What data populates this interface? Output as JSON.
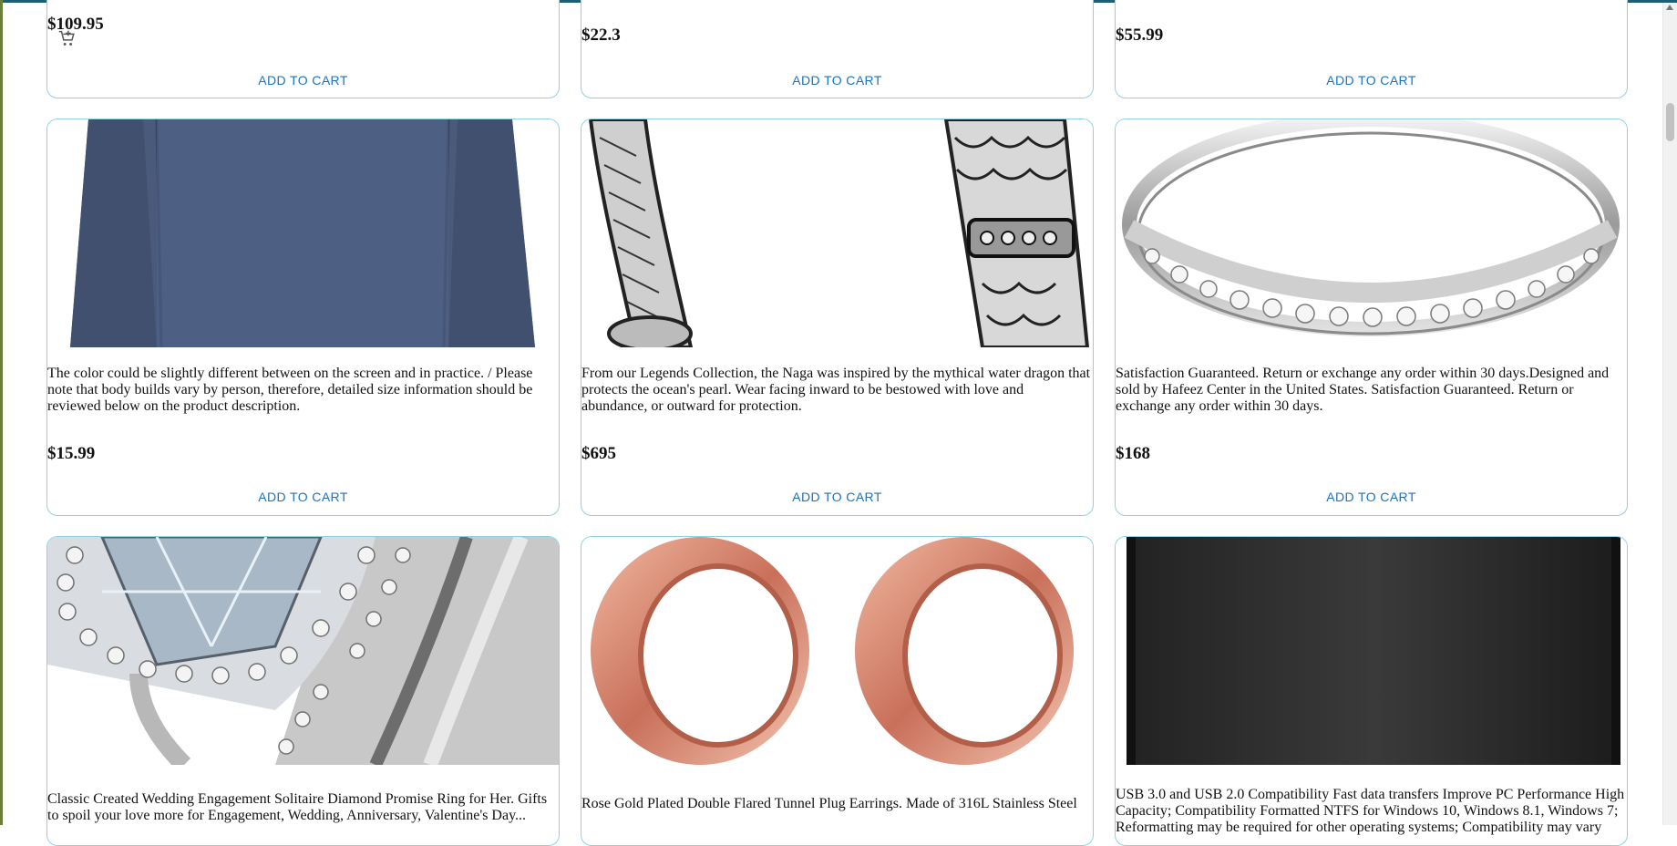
{
  "products": [
    {
      "price": "$109.95",
      "cta": "ADD TO CART"
    },
    {
      "price": "$22.3",
      "cta": "ADD TO CART"
    },
    {
      "price": "$55.99",
      "cta": "ADD TO CART"
    },
    {
      "description": "The color could be slightly different between on the screen and in practice. / Please note that body builds vary by person, therefore, detailed size information should be reviewed below on the product description.",
      "price": "$15.99",
      "cta": "ADD TO CART"
    },
    {
      "description": "From our Legends Collection, the Naga was inspired by the mythical water dragon that protects the ocean's pearl. Wear facing inward to be bestowed with love and abundance, or outward for protection.",
      "price": "$695",
      "cta": "ADD TO CART"
    },
    {
      "description": "Satisfaction Guaranteed. Return or exchange any order within 30 days.Designed and sold by Hafeez Center in the United States. Satisfaction Guaranteed. Return or exchange any order within 30 days.",
      "price": "$168",
      "cta": "ADD TO CART"
    },
    {
      "description": "Classic Created Wedding Engagement Solitaire Diamond Promise Ring for Her. Gifts to spoil your love more for Engagement, Wedding, Anniversary, Valentine's Day..."
    },
    {
      "description": "Rose Gold Plated Double Flared Tunnel Plug Earrings. Made of 316L Stainless Steel"
    },
    {
      "description": "USB 3.0 and USB 2.0 Compatibility Fast data transfers Improve PC Performance High Capacity; Compatibility Formatted NTFS for Windows 10, Windows 8.1, Windows 7; Reformatting may be required for other operating systems; Compatibility may vary"
    }
  ],
  "icons": {
    "cart": "cart-add-icon"
  },
  "colors": {
    "card_border": "#8fd3e0",
    "cta": "#1e73be"
  }
}
